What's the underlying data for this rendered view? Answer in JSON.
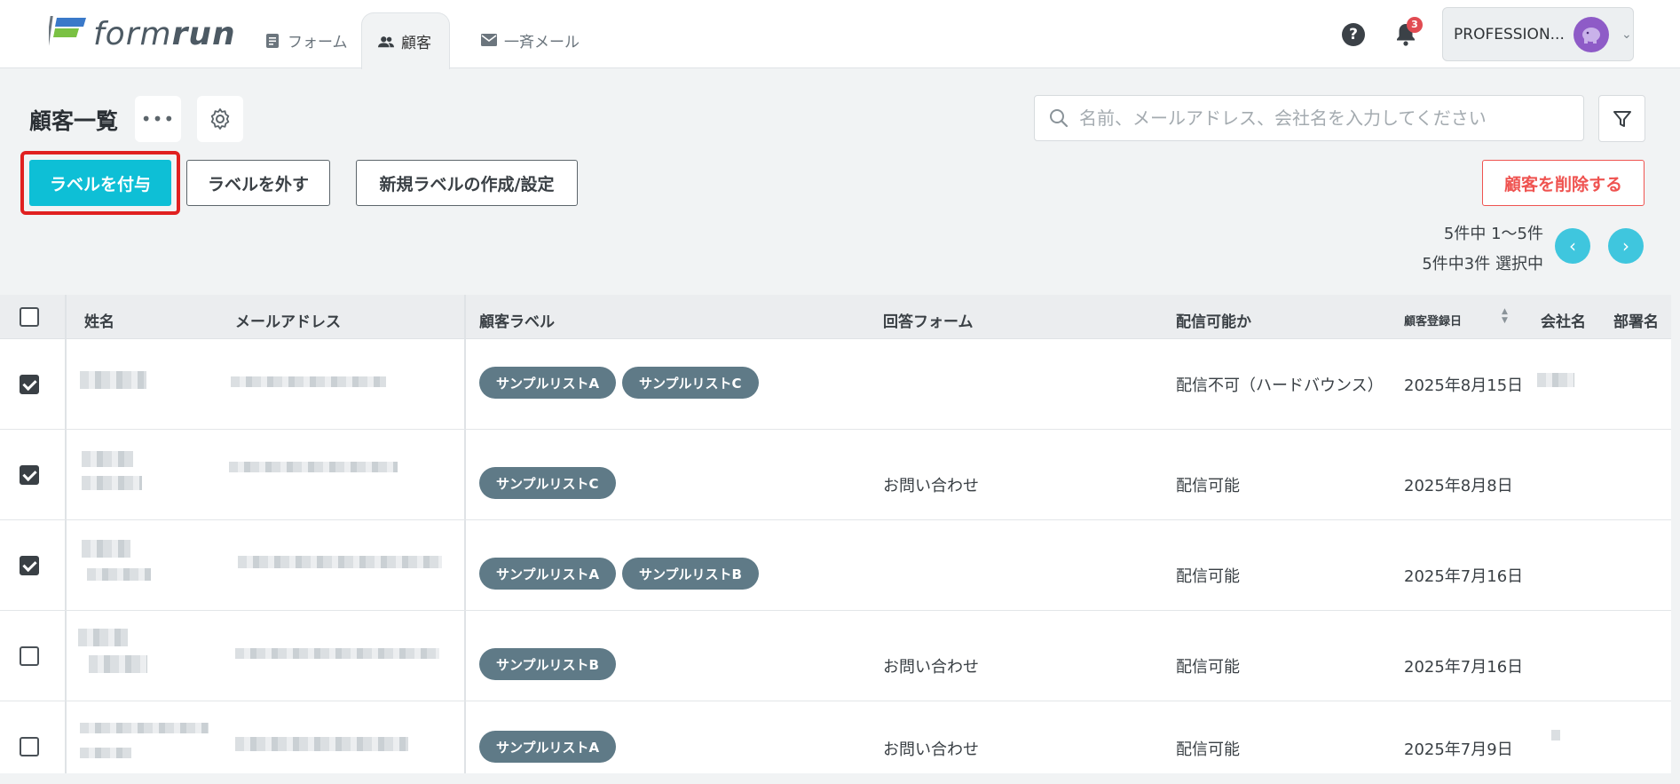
{
  "brand": {
    "logo_text_a": "form",
    "logo_text_b": "run"
  },
  "nav": {
    "tabs": [
      {
        "label": "フォーム",
        "icon": "form-icon"
      },
      {
        "label": "顧客",
        "icon": "people-icon",
        "active": true
      },
      {
        "label": "一斉メール",
        "icon": "mail-icon"
      }
    ],
    "help": "?",
    "notifications": "3",
    "plan": "PROFESSION..."
  },
  "toolbar": {
    "title": "顧客一覧",
    "more": "•••",
    "search_placeholder": "名前、メールアドレス、会社名を入力してください",
    "assign_label": "ラベルを付与",
    "remove_label": "ラベルを外す",
    "new_label": "新規ラベルの作成/設定",
    "delete_label": "顧客を削除する",
    "count_text": "5件中 1〜5件",
    "selected_text": "5件中3件 選択中"
  },
  "table": {
    "headers": {
      "name": "姓名",
      "email": "メールアドレス",
      "labels": "顧客ラベル",
      "form": "回答フォーム",
      "deliverable": "配信可能か",
      "registered": "顧客登録日",
      "company": "会社名",
      "department": "部署名"
    },
    "rows": [
      {
        "checked": true,
        "labels": [
          "サンプルリストA",
          "サンプルリストC"
        ],
        "form": "",
        "deliverable": "配信不可（ハードバウンス）",
        "registered": "2025年8月15日"
      },
      {
        "checked": true,
        "labels": [
          "サンプルリストC"
        ],
        "form": "お問い合わせ",
        "deliverable": "配信可能",
        "registered": "2025年8月8日"
      },
      {
        "checked": true,
        "labels": [
          "サンプルリストA",
          "サンプルリストB"
        ],
        "form": "",
        "deliverable": "配信可能",
        "registered": "2025年7月16日"
      },
      {
        "checked": false,
        "labels": [
          "サンプルリストB"
        ],
        "form": "お問い合わせ",
        "deliverable": "配信可能",
        "registered": "2025年7月16日"
      },
      {
        "checked": false,
        "labels": [
          "サンプルリストA"
        ],
        "form": "お問い合わせ",
        "deliverable": "配信可能",
        "registered": "2025年7月9日"
      }
    ]
  },
  "colors": {
    "accent": "#0ebfd6",
    "chip": "#5f7a87",
    "danger": "#ef5350",
    "highlight": "#e02020"
  }
}
